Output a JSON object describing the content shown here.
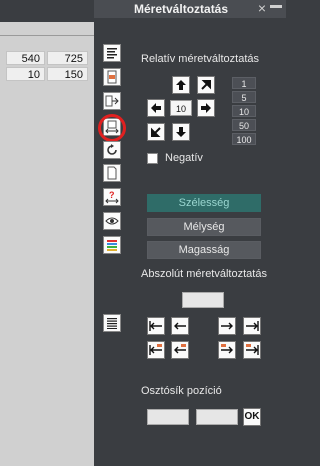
{
  "window": {
    "title": "Méretváltoztatás"
  },
  "spreadsheet": {
    "row1": [
      "540",
      "725"
    ],
    "row2": [
      "10",
      "150"
    ]
  },
  "toolbar_icons": [
    "align-stack-icon",
    "column-highlight-icon",
    "move-right-icon",
    "resize-icon",
    "rotate-icon",
    "page-icon",
    "question-arrow-icon",
    "eye-icon",
    "color-bars-icon",
    "list-icon"
  ],
  "relative": {
    "heading": "Relatív méretváltoztatás",
    "step_value": "10",
    "steps": [
      "1",
      "5",
      "10",
      "50",
      "100"
    ],
    "negative_label": "Negatív"
  },
  "dimensions": {
    "width_label": "Szélesség",
    "depth_label": "Mélység",
    "height_label": "Magasság"
  },
  "absolute": {
    "heading": "Abszolút méretváltoztatás"
  },
  "divider": {
    "heading": "Osztósík pozíció",
    "ok_label": "OK"
  },
  "colors": {
    "accent": "#2f6c68",
    "highlight": "#e02020"
  }
}
